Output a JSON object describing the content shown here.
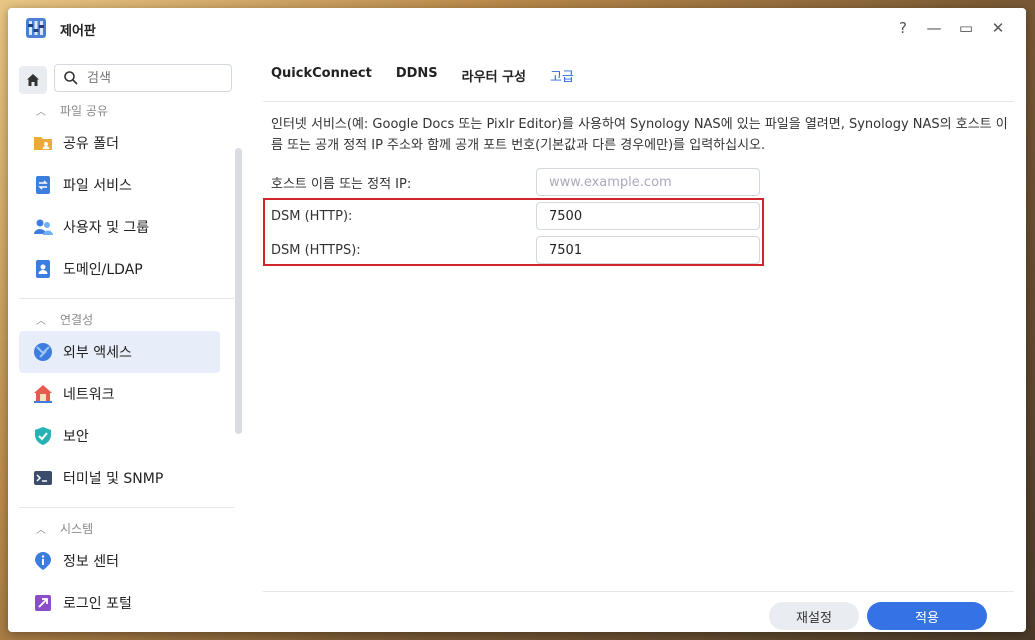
{
  "window": {
    "title": "제어판",
    "help_label": "?",
    "minimize_label": "—",
    "maximize_label": "▭",
    "close_label": "✕"
  },
  "sidebar": {
    "search_placeholder": "검색",
    "sections": [
      {
        "title": "파일 공유",
        "items": [
          "공유 폴더",
          "파일 서비스",
          "사용자 및 그룹",
          "도메인/LDAP"
        ]
      },
      {
        "title": "연결성",
        "items": [
          "외부 액세스",
          "네트워크",
          "보안",
          "터미널 및 SNMP"
        ]
      },
      {
        "title": "시스템",
        "items": [
          "정보 센터",
          "로그인 포털"
        ]
      }
    ],
    "active_item": "외부 액세스"
  },
  "tabs": [
    {
      "label": "QuickConnect",
      "active": false
    },
    {
      "label": "DDNS",
      "active": false
    },
    {
      "label": "라우터 구성",
      "active": false
    },
    {
      "label": "고급",
      "active": true
    }
  ],
  "main": {
    "description": "인터넷 서비스(예: Google Docs 또는 Pixlr Editor)를 사용하여 Synology NAS에 있는 파일을 열려면, Synology NAS의 호스트 이름 또는 공개 정적 IP 주소와 함께 공개 포트 번호(기본값과 다른 경우에만)를 입력하십시오.",
    "hostname_label": "호스트 이름 또는 정적 IP:",
    "hostname_placeholder": "www.example.com",
    "http_label": "DSM (HTTP):",
    "http_value": "7500",
    "https_label": "DSM (HTTPS):",
    "https_value": "7501"
  },
  "footer": {
    "reset_label": "재설정",
    "apply_label": "적용"
  },
  "colors": {
    "accent": "#3572e4",
    "highlight": "#d0232b",
    "active_tab": "#2f6bd9"
  }
}
